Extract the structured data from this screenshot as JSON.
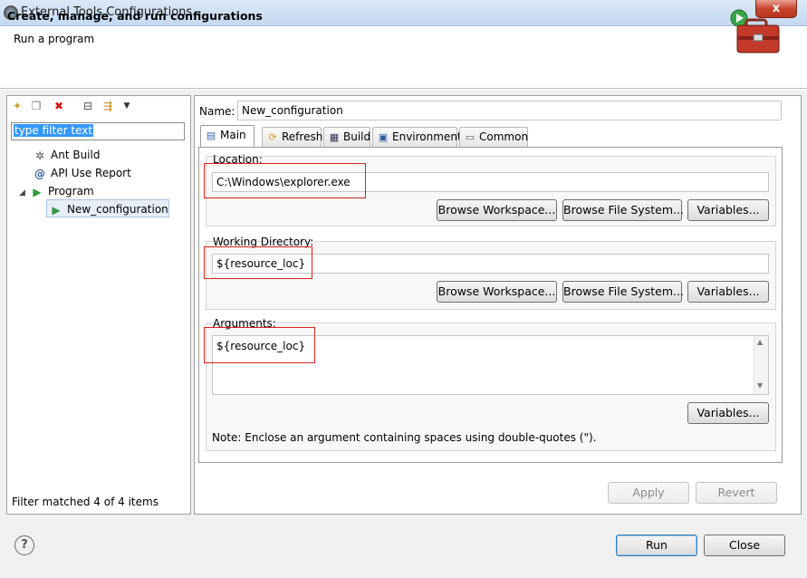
{
  "window": {
    "title": "External Tools Configurations",
    "close_glyph": "x"
  },
  "header": {
    "title": "Create, manage, and run configurations",
    "subtitle": "Run a program"
  },
  "sidebar": {
    "filter_text": "type filter text",
    "tree": [
      {
        "label": "Ant Build",
        "icon": "ant-icon"
      },
      {
        "label": "API Use Report",
        "icon": "api-report-icon"
      },
      {
        "label": "Program",
        "icon": "program-icon",
        "expanded": true
      },
      {
        "label": "New_configuration",
        "icon": "program-config-icon",
        "selected": true
      }
    ],
    "status": "Filter matched 4 of 4 items"
  },
  "config": {
    "name_label": "Name:",
    "name_value": "New_configuration",
    "tabs": [
      "Main",
      "Refresh",
      "Build",
      "Environment",
      "Common"
    ],
    "location": {
      "label": "Location:",
      "value": "C:\\Windows\\explorer.exe"
    },
    "working_dir": {
      "label": "Working Directory:",
      "value": "${resource_loc}"
    },
    "arguments": {
      "label": "Arguments:",
      "value": "${resource_loc}"
    },
    "browse_workspace": "Browse Workspace...",
    "browse_fs": "Browse File System...",
    "variables": "Variables...",
    "note": "Note: Enclose an argument containing spaces using double-quotes (\")."
  },
  "buttons": {
    "apply": "Apply",
    "revert": "Revert",
    "run": "Run",
    "close": "Close"
  },
  "colors": {
    "highlight_box": "#d92020",
    "selection": "#3399ff"
  }
}
